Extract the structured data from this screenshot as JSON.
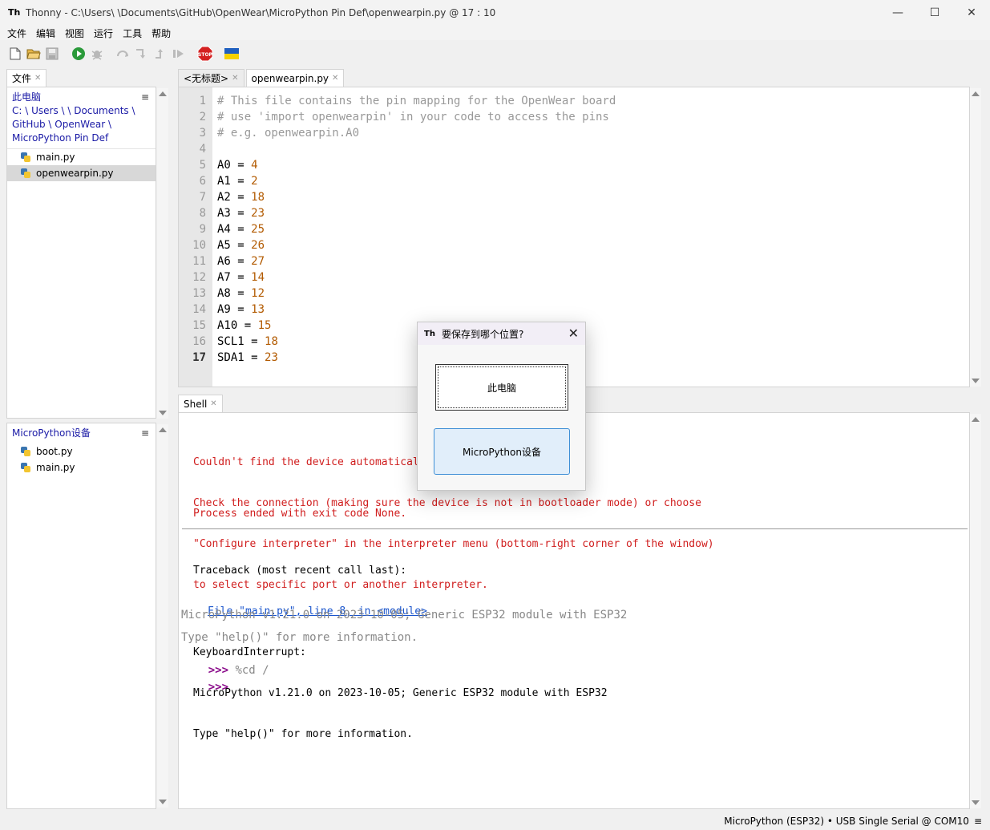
{
  "window": {
    "app_name": "Thonny",
    "title": "Thonny  -  C:\\Users\\      \\Documents\\GitHub\\OpenWear\\MicroPython Pin Def\\openwearpin.py  @  17 : 10",
    "minimize": "—",
    "maximize": "☐",
    "close": "✕"
  },
  "menu": [
    "文件",
    "编辑",
    "视图",
    "运行",
    "工具",
    "帮助"
  ],
  "files_panel": {
    "tab_label": "文件",
    "local": {
      "header": "此电脑",
      "path": "C: \\ Users \\      \\ Documents \\ GitHub \\ OpenWear \\ MicroPython Pin Def",
      "files": [
        "main.py",
        "openwearpin.py"
      ],
      "selected": "openwearpin.py"
    },
    "device": {
      "header": "MicroPython设备",
      "files": [
        "boot.py",
        "main.py"
      ]
    }
  },
  "editor": {
    "tabs": [
      {
        "label": "<无标题>",
        "active": false
      },
      {
        "label": "openwearpin.py",
        "active": true
      }
    ],
    "current_line": 17,
    "lines": [
      {
        "n": "1",
        "text": "# This file contains the pin mapping for the OpenWear board"
      },
      {
        "n": "2",
        "text": "# use 'import openwearpin' in your code to access the pins"
      },
      {
        "n": "3",
        "text": "# e.g. openwearpin.A0"
      },
      {
        "n": "4",
        "text": ""
      },
      {
        "n": "5",
        "name": "A0",
        "value": "4"
      },
      {
        "n": "6",
        "name": "A1",
        "value": "2"
      },
      {
        "n": "7",
        "name": "A2",
        "value": "18"
      },
      {
        "n": "8",
        "name": "A3",
        "value": "23"
      },
      {
        "n": "9",
        "name": "A4",
        "value": "25"
      },
      {
        "n": "10",
        "name": "A5",
        "value": "26"
      },
      {
        "n": "11",
        "name": "A6",
        "value": "27"
      },
      {
        "n": "12",
        "name": "A7",
        "value": "14"
      },
      {
        "n": "13",
        "name": "A8",
        "value": "12"
      },
      {
        "n": "14",
        "name": "A9",
        "value": "13"
      },
      {
        "n": "15",
        "name": "A10",
        "value": "15"
      },
      {
        "n": "16",
        "name": "SCL1",
        "value": "18"
      },
      {
        "n": "17",
        "name": "SDA1",
        "value": "23"
      }
    ]
  },
  "shell": {
    "tab_label": "Shell",
    "error_lines": [
      "Couldn't find the device automatically.",
      "Check the connection (making sure the device is not in bootloader mode) or choose",
      "\"Configure interpreter\" in the interpreter menu (bottom-right corner of the window)",
      "to select specific port or another interpreter."
    ],
    "process_end": "Process ended with exit code None.",
    "traceback_head": "Traceback (most recent call last):",
    "traceback_link": "File \"main.py\", line 8, in <module>",
    "traceback_lines": [
      "KeyboardInterrupt:",
      "MicroPython v1.21.0 on 2023-10-05; Generic ESP32 module with ESP32",
      "Type \"help()\" for more information."
    ],
    "banner1": "MicroPython v1.21.0 on 2023-10-05; Generic ESP32 module with ESP32",
    "banner2": "Type \"help()\" for more information.",
    "prompt": ">>>",
    "command": "%cd /"
  },
  "status": {
    "interpreter": "MicroPython (ESP32)  •  USB Single Serial @ COM10",
    "menu_glyph": "≡"
  },
  "dialog": {
    "title": "要保存到哪个位置?",
    "option_local": "此电脑",
    "option_device": "MicroPython设备"
  },
  "colors": {
    "error": "#d01d1d",
    "number": "#b25a00",
    "comment": "#999999",
    "link": "#1a55cc",
    "prompt": "#8b0c8b",
    "dialog_accent": "#3f8fd6"
  }
}
